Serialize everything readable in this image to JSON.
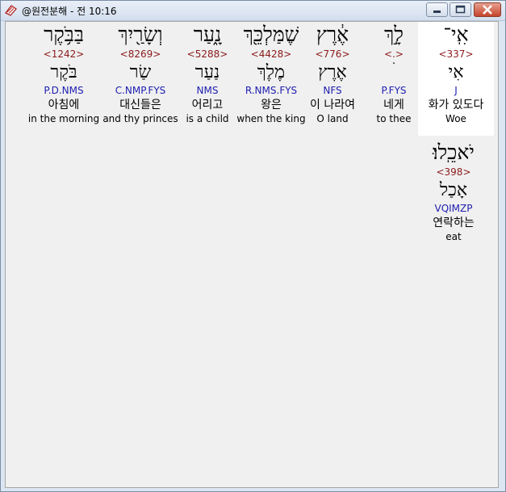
{
  "window": {
    "title": "@원전분해 - 전 10:16",
    "icon": "app-book-icon",
    "controls": [
      "minimize-icon",
      "maximize-icon",
      "close-icon"
    ]
  },
  "words": [
    {
      "word": "אִֽי־",
      "strong": "<337>",
      "root": "אִי",
      "morph": "J",
      "korean": "화가 있도다",
      "english": "Woe"
    },
    {
      "word": "לָ֣ךְ",
      "strong": "<.>",
      "root": "ׄ",
      "morph": "P.FYS",
      "korean": "네게",
      "english": "to thee"
    },
    {
      "word": "אֶ֔רֶץ",
      "strong": "<776>",
      "root": "אֶרֶץ",
      "morph": "NFS",
      "korean": "이 나라여",
      "english": "O land"
    },
    {
      "word": "שֶׁמַּלְכֵּ֖ךְ",
      "strong": "<4428>",
      "root": "מֶלֶךְ",
      "morph": "R.NMS.FYS",
      "korean": "왕은",
      "english": "when the king"
    },
    {
      "word": "נָ֑עַר",
      "strong": "<5288>",
      "root": "נַעַר",
      "morph": "NMS",
      "korean": "어리고",
      "english": "is a child"
    },
    {
      "word": "וְשָׂרַ֖יִךְ",
      "strong": "<8269>",
      "root": "שַׂר",
      "morph": "C.NMP.FYS",
      "korean": "대신들은",
      "english": "and thy princes"
    },
    {
      "word": "בַּבֹּ֥קֶר",
      "strong": "<1242>",
      "root": "בֹּקֶר",
      "morph": "P.D.NMS",
      "korean": "아침에",
      "english": "in the morning"
    },
    {
      "word": "יֹאכֵֽלוּ׃",
      "strong": "<398>",
      "root": "אָכַל",
      "morph": "VQIMZP",
      "korean": "연락하는",
      "english": "eat"
    }
  ],
  "colors": {
    "strong": "#8b1a1a",
    "morph": "#2020b0",
    "highlight": "#ffffff",
    "background": "#f0f0f0"
  }
}
